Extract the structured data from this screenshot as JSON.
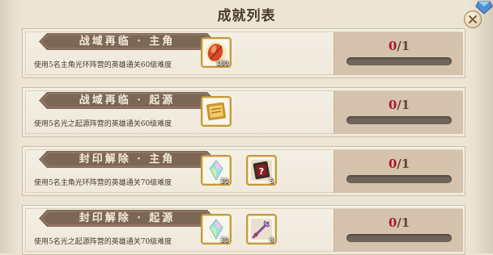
{
  "title": "成就列表",
  "colors": {
    "accent_gold": "#c49a3a",
    "progress_current": "#b4162c",
    "title_banner": "#7c6656"
  },
  "achievements": [
    {
      "title": "战域再临 · 主角",
      "description": "使用5名主角光环阵营的英雄通关60级难度",
      "rewards": [
        {
          "icon": "red-gem-icon",
          "count": "180"
        }
      ],
      "progress": {
        "current": "0",
        "separator": "/",
        "total": "1",
        "fraction": 0
      }
    },
    {
      "title": "战域再临 · 起源",
      "description": "使用5名光之起源阵营的英雄通关60级难度",
      "rewards": [
        {
          "icon": "gold-ticket-icon",
          "count": ""
        }
      ],
      "progress": {
        "current": "0",
        "separator": "/",
        "total": "1",
        "fraction": 0
      }
    },
    {
      "title": "封印解除 · 主角",
      "description": "使用5名主角光环阵营的英雄通关70级难度",
      "rewards": [
        {
          "icon": "rainbow-crystal-icon",
          "count": "30"
        },
        {
          "icon": "mystery-scroll-icon",
          "count": "5"
        }
      ],
      "progress": {
        "current": "0",
        "separator": "/",
        "total": "1",
        "fraction": 0
      }
    },
    {
      "title": "封印解除 · 起源",
      "description": "使用5名光之起源阵营的英雄通关70级难度",
      "rewards": [
        {
          "icon": "rainbow-crystal-icon",
          "count": "30"
        },
        {
          "icon": "purple-weapon-icon",
          "count": "8"
        }
      ],
      "progress": {
        "current": "0",
        "separator": "/",
        "total": "1",
        "fraction": 0
      }
    }
  ]
}
